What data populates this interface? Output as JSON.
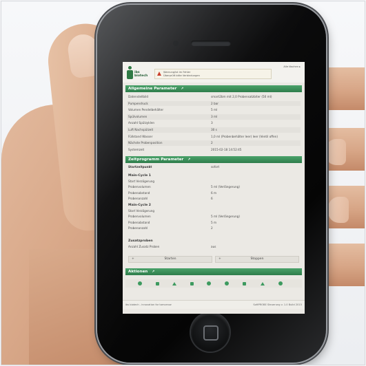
{
  "topbar": {
    "logo_text": "ibs\nbiotech",
    "alert_line1": "Warnung/ist im Fehler",
    "alert_line2": "Überprüft bitte Verbindungen",
    "top_link": "Alle löschen ▸"
  },
  "section1": {
    "title": "Allgemeine Parameter",
    "chevron": "↗",
    "rows": [
      {
        "label": "Datenstellbild",
        "value": "smart2bm mit 2,0 Probensatzbiter (50 ml)"
      },
      {
        "label": "Pumpendruck",
        "value": "2 bar"
      },
      {
        "label": "Volumen Pendelbehälter",
        "value": "5 ml"
      },
      {
        "label": "Spülvolumen",
        "value": "3 ml"
      },
      {
        "label": "Anzahl Spülzyklen",
        "value": "3"
      },
      {
        "label": "Luft Nachspülzeit",
        "value": "30 s"
      },
      {
        "label": "Füllstand Wasser",
        "value": "1,0 ml (Probenbehälter leer) leer (Ventil offen)"
      },
      {
        "label": "Nächste Probenposition",
        "value": "2"
      },
      {
        "label": "Systemzeit",
        "value": "2015-02-18 14:52:45"
      }
    ]
  },
  "section2": {
    "title": "Zeitprogramm Parameter",
    "chevron": "↗",
    "start_label": "Startzeitpunkt",
    "start_value": "sofort",
    "cycle1": {
      "title": "Main-Cycle 1",
      "rows": [
        {
          "label": "Start Verzögerung",
          "value": ""
        },
        {
          "label": "Probenvolumen",
          "value": "5 ml (Verlängerung)"
        },
        {
          "label": "Probenabstand",
          "value": "6 m"
        },
        {
          "label": "Probenanzahl",
          "value": "6"
        }
      ]
    },
    "cycle2": {
      "title": "Main-Cycle 2",
      "rows": [
        {
          "label": "Start Verzögerung",
          "value": ""
        },
        {
          "label": "Probenvolumen",
          "value": "5 ml (Verlängerung)"
        },
        {
          "label": "Probenabstand",
          "value": "5 m"
        },
        {
          "label": "Probenanzahl",
          "value": "2"
        }
      ]
    },
    "extra": {
      "title": "Zusatzproben",
      "rows": [
        {
          "label": "Anzahl Zusatz Proben",
          "value": "aus"
        }
      ]
    },
    "buttons": {
      "start": "Starten",
      "stop": "Stoppen",
      "plus": "+"
    }
  },
  "section3": {
    "title": "Aktionen",
    "chevron": "↗"
  },
  "footer": {
    "left": "ibs biotech - innovation for tomorrow",
    "right": "SoftPROBE Steuerung v. 1.0 Build 2015"
  },
  "colors": {
    "accent_green": "#2f7d4b",
    "alert_red": "#c93d2b",
    "screen_bg": "#ebe9e4"
  },
  "icons": {
    "alert": "warning-triangle-icon",
    "home": "home-button-icon"
  }
}
